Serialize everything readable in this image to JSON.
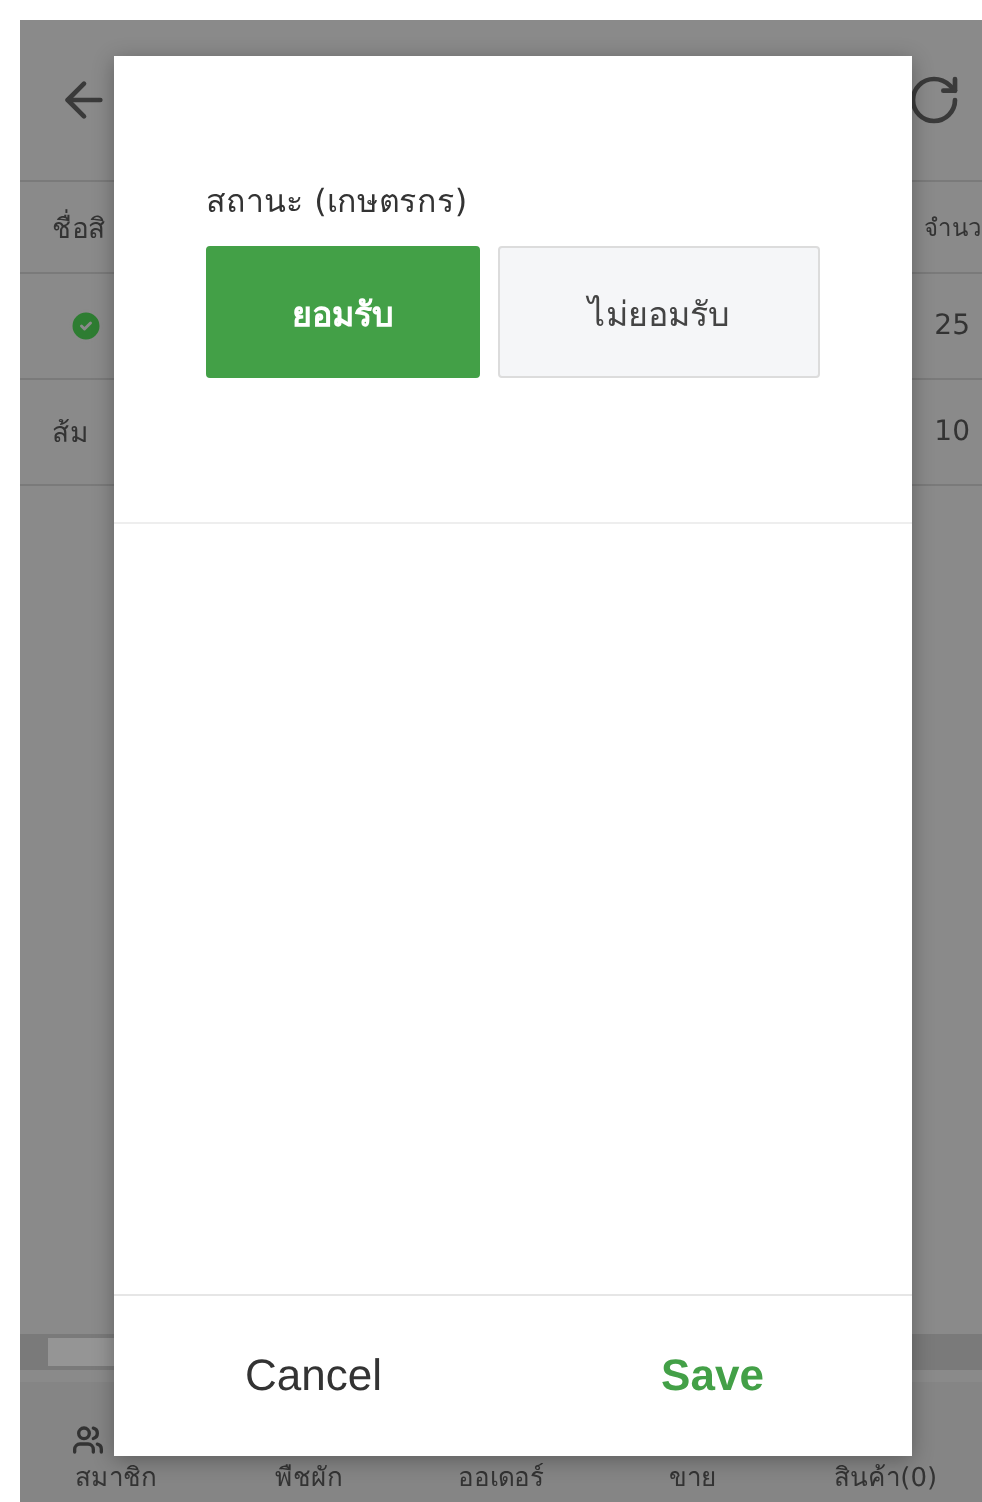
{
  "table": {
    "columns": [
      "ชื่อสิ",
      "จำนว"
    ],
    "rows": [
      {
        "approved": true,
        "qty": "25"
      },
      {
        "name": "ส้ม",
        "approved": false,
        "qty": "10"
      }
    ]
  },
  "bottom_nav": [
    {
      "label": "สมาชิก"
    },
    {
      "label": "พืชผัก"
    },
    {
      "label": "ออเดอร์"
    },
    {
      "label": "ขาย"
    },
    {
      "label": "สินค้า(0)"
    }
  ],
  "dialog": {
    "field_label": "สถานะ (เกษตรกร)",
    "options": [
      {
        "label": "ยอมรับ",
        "selected": true
      },
      {
        "label": "ไม่ยอมรับ",
        "selected": false
      }
    ],
    "actions": [
      {
        "label": "Cancel",
        "kind": "secondary"
      },
      {
        "label": "Save",
        "kind": "primary"
      }
    ]
  }
}
